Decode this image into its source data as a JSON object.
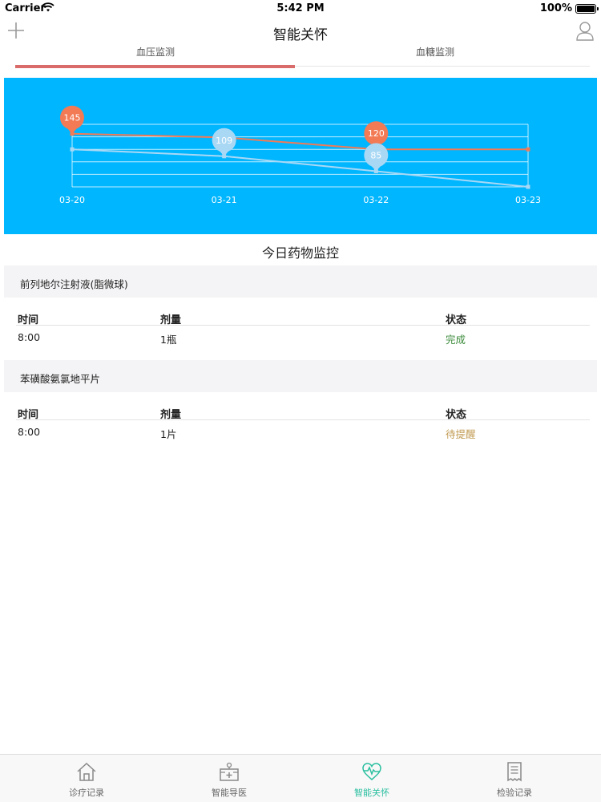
{
  "status_bar": {
    "carrier": "Carrier",
    "time": "5:42 PM",
    "battery": "100%"
  },
  "nav": {
    "title": "智能关怀"
  },
  "tabs": [
    {
      "label": "血压监测",
      "active": true
    },
    {
      "label": "血糖监测",
      "active": false
    }
  ],
  "chart_data": {
    "type": "line",
    "x": [
      "03-20",
      "03-21",
      "03-22",
      "03-23"
    ],
    "ylim": [
      60,
      160
    ],
    "grid": true,
    "series": [
      {
        "name": "",
        "color": "#f27a55",
        "values": [
          145,
          139,
          120,
          120
        ],
        "point_labels": [
          "145",
          null,
          "120",
          null
        ]
      },
      {
        "name": "",
        "color": "#a9d8f5",
        "values": [
          120,
          109,
          85,
          60
        ],
        "point_labels": [
          null,
          "109",
          "85",
          null
        ]
      }
    ]
  },
  "section_title": "今日药物监控",
  "medications": [
    {
      "name": "前列地尔注射液(脂微球)",
      "headers": {
        "time": "时间",
        "dose": "剂量",
        "status": "状态"
      },
      "time": "8:00",
      "dose": "1瓶",
      "status": "完成",
      "status_color": "#3a8a3a"
    },
    {
      "name": "苯磺酸氨氯地平片",
      "headers": {
        "time": "时间",
        "dose": "剂量",
        "status": "状态"
      },
      "time": "8:00",
      "dose": "1片",
      "status": "待提醒",
      "status_color": "#c09a50"
    }
  ],
  "tab_bar": [
    {
      "label": "诊疗记录",
      "icon": "home-icon",
      "active": false
    },
    {
      "label": "智能导医",
      "icon": "guide-icon",
      "active": false
    },
    {
      "label": "智能关怀",
      "icon": "heart-pulse-icon",
      "active": true
    },
    {
      "label": "检验记录",
      "icon": "receipt-icon",
      "active": false
    }
  ]
}
